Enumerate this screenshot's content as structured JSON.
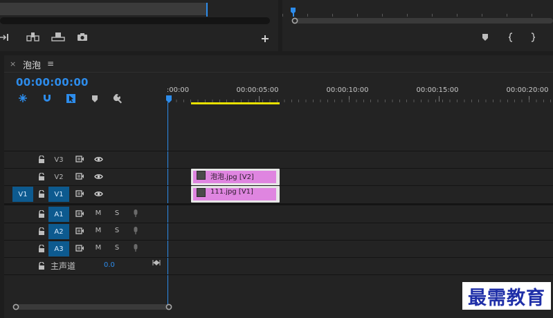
{
  "source_monitor": {
    "controls": [
      "step-forward-icon",
      "insert-icon",
      "overwrite-icon",
      "export-frame-icon",
      "plus-icon"
    ]
  },
  "program_monitor": {
    "controls": [
      "marker-icon",
      "mark-in-icon",
      "mark-out-icon"
    ]
  },
  "sequence": {
    "close_glyph": "×",
    "name": "泡泡",
    "menu_glyph": "≡",
    "timecode": "00:00:00:00",
    "tools": [
      "snap-icon",
      "linked-selection-icon",
      "add-marker-tool-icon",
      "marker-icon",
      "wrench-icon"
    ]
  },
  "ruler": {
    "labels": [
      ":00:00",
      "00:00:05:00",
      "00:00:10:00",
      "00:00:15:00",
      "00:00:20:00"
    ]
  },
  "video_tracks": [
    {
      "id": "V3",
      "source_patch": "",
      "targeted": false
    },
    {
      "id": "V2",
      "source_patch": "",
      "targeted": false
    },
    {
      "id": "V1",
      "source_patch": "V1",
      "targeted": true
    }
  ],
  "audio_tracks": [
    {
      "id": "A1",
      "mute": "M",
      "solo": "S"
    },
    {
      "id": "A2",
      "mute": "M",
      "solo": "S"
    },
    {
      "id": "A3",
      "mute": "M",
      "solo": "S"
    }
  ],
  "master": {
    "label": "主声道",
    "value": "0.0"
  },
  "clips": {
    "v2": "泡泡.jpg [V2]",
    "v1": "111.jpg [V1]"
  },
  "colors": {
    "accent_blue": "#2d8ceb",
    "clip_pink": "#df85e0",
    "work_area_yellow": "#e8e000",
    "track_target_blue": "#0d5a8f"
  },
  "watermark": {
    "text": "最需教育"
  }
}
